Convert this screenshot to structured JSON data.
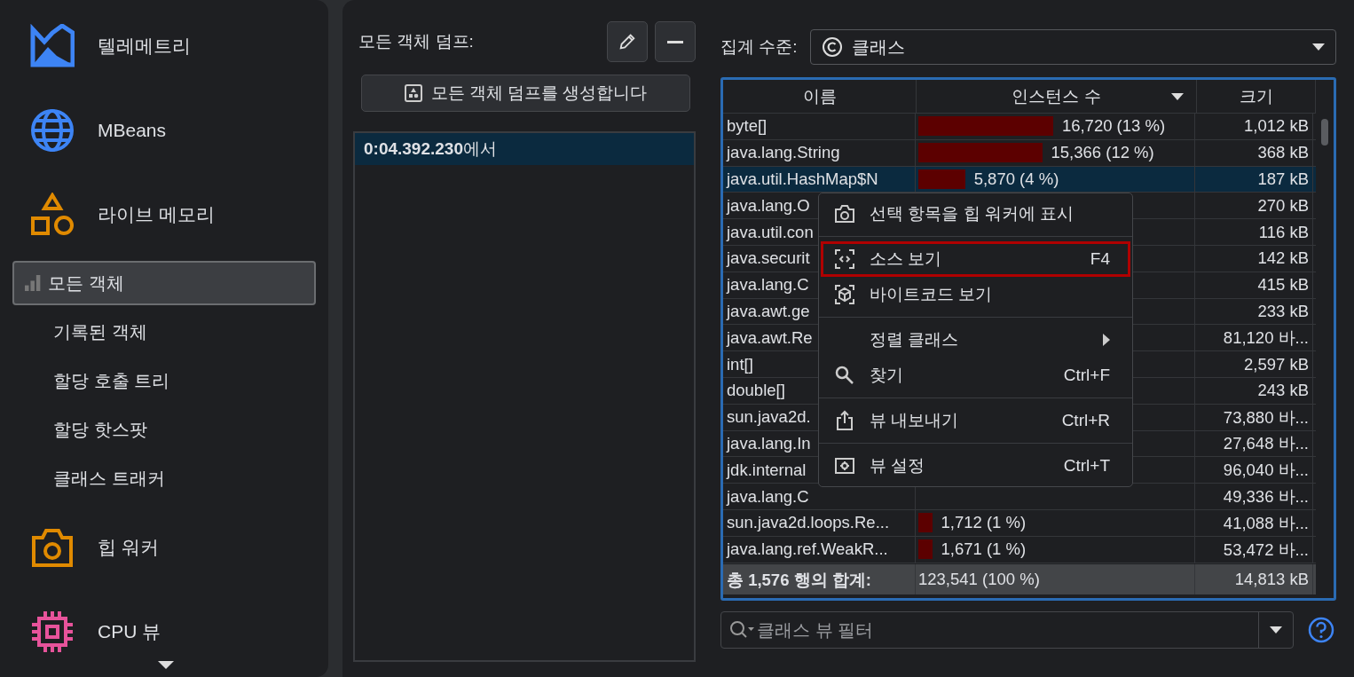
{
  "sidebar": {
    "items": [
      {
        "label": "텔레메트리"
      },
      {
        "label": "MBeans"
      },
      {
        "label": "라이브 메모리",
        "children": [
          {
            "label": "모든 객체",
            "selected": true
          },
          {
            "label": "기록된 객체",
            "selected": false
          },
          {
            "label": "할당 호출 트리",
            "selected": false
          },
          {
            "label": "할당 핫스팟",
            "selected": false
          },
          {
            "label": "클래스 트래커",
            "selected": false
          }
        ]
      },
      {
        "label": "힙 워커"
      },
      {
        "label": "CPU 뷰"
      }
    ]
  },
  "dumps": {
    "label": "모든 객체 덤프:",
    "create_button": "모든 객체 덤프를 생성합니다",
    "items": [
      {
        "time": "0:04.392.230",
        "suffix": "에서",
        "selected": true
      }
    ]
  },
  "aggregation": {
    "label": "집계 수준:",
    "value": "클래스"
  },
  "table": {
    "columns": [
      {
        "label": "이름",
        "sorted": false
      },
      {
        "label": "인스턴스 수",
        "sorted": true
      },
      {
        "label": "크기",
        "sorted": false
      }
    ],
    "rows": [
      {
        "name": "byte[]",
        "instances": "16,720 (13 %)",
        "level": 0.49,
        "size": "1,012 kB",
        "selected": false
      },
      {
        "name": "java.lang.String",
        "instances": "15,366 (12 %)",
        "level": 0.45,
        "size": "368 kB",
        "selected": false
      },
      {
        "name": "java.util.HashMap$N",
        "instances": "5,870 (4 %)",
        "level": 0.17,
        "size": "187 kB",
        "selected": true
      },
      {
        "name": "java.lang.O",
        "size": "270 kB",
        "selected": false
      },
      {
        "name": "java.util.con",
        "size": "116 kB",
        "selected": false
      },
      {
        "name": "java.securit",
        "size": "142 kB",
        "selected": false
      },
      {
        "name": "java.lang.C",
        "size": "415 kB",
        "selected": false
      },
      {
        "name": "java.awt.ge",
        "size": "233 kB",
        "selected": false
      },
      {
        "name": "java.awt.Re",
        "size": "81,120 바...",
        "selected": false
      },
      {
        "name": "int[]",
        "size": "2,597 kB",
        "selected": false
      },
      {
        "name": "double[]",
        "size": "243 kB",
        "selected": false
      },
      {
        "name": "sun.java2d.",
        "size": "73,880 바...",
        "selected": false
      },
      {
        "name": "java.lang.In",
        "size": "27,648 바...",
        "selected": false
      },
      {
        "name": "jdk.internal",
        "size": "96,040 바...",
        "selected": false
      },
      {
        "name": "java.lang.C",
        "size": "49,336 바...",
        "selected": false
      },
      {
        "name": "sun.java2d.loops.Re...",
        "instances": "1,712 (1 %)",
        "level": 0.05,
        "size": "41,088 바...",
        "selected": false
      },
      {
        "name": "java.lang.ref.WeakR...",
        "instances": "1,671 (1 %)",
        "level": 0.05,
        "size": "53,472 바...",
        "selected": false
      }
    ],
    "footer": {
      "name": "총 1,576 행의 합계:",
      "instances": "123,541 (100 %)",
      "size": "14,813 kB"
    }
  },
  "context_menu": {
    "items": [
      {
        "kind": "item",
        "label": "선택 항목을 힙 워커에 표시",
        "selected": false
      },
      {
        "kind": "separator"
      },
      {
        "kind": "item",
        "label": "소스 보기",
        "shortcut": "F4",
        "selected": true
      },
      {
        "kind": "item",
        "label": "바이트코드 보기",
        "selected": false
      },
      {
        "kind": "separator"
      },
      {
        "kind": "submenu",
        "label": "정렬 클래스",
        "selected": false
      },
      {
        "kind": "item",
        "label": "찾기",
        "shortcut": "Ctrl+F",
        "selected": false
      },
      {
        "kind": "separator"
      },
      {
        "kind": "item",
        "label": "뷰 내보내기",
        "shortcut": "Ctrl+R",
        "selected": false
      },
      {
        "kind": "separator"
      },
      {
        "kind": "item",
        "label": "뷰 설정",
        "shortcut": "Ctrl+T",
        "selected": false
      }
    ]
  },
  "filter": {
    "placeholder": "클래스 뷰 필터"
  }
}
